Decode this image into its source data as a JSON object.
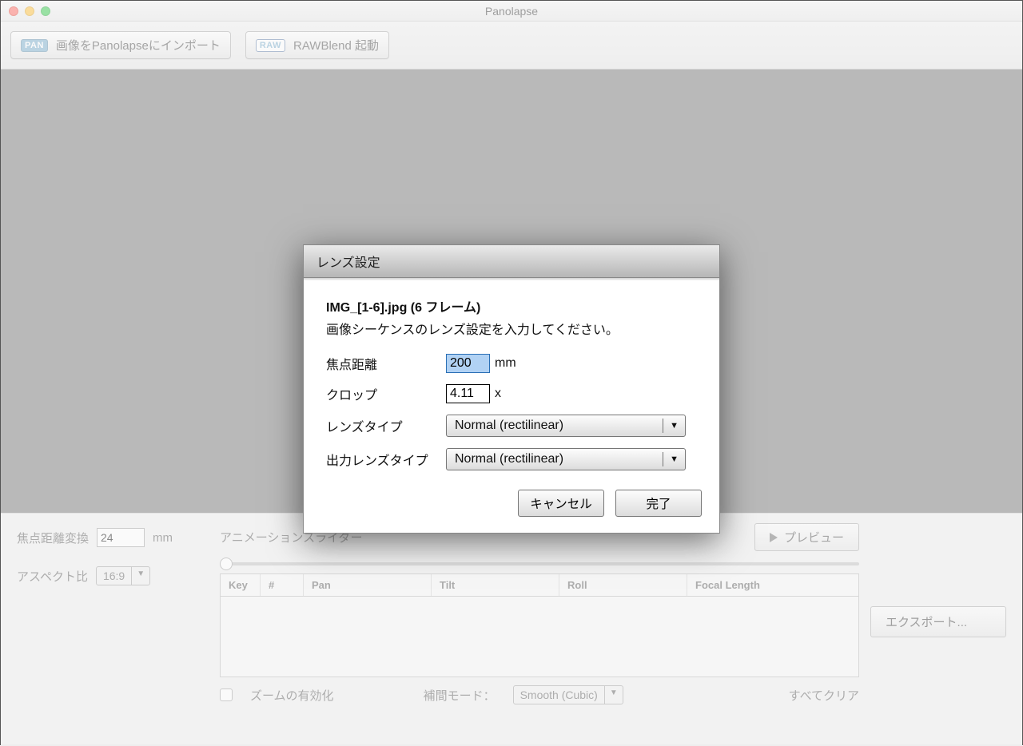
{
  "window": {
    "title": "Panolapse"
  },
  "toolbar": {
    "import_badge": "PAN",
    "import_label": "画像をPanolapseにインポート",
    "raw_badge": "RAW",
    "raw_label": "RAWBlend 起動"
  },
  "left": {
    "focal_conv_label": "焦点距離変換",
    "focal_conv_value": "24",
    "focal_conv_unit": "mm",
    "aspect_label": "アスペクト比",
    "aspect_value": "16:9"
  },
  "right": {
    "anim_label": "アニメーションスライダー",
    "preview": "プレビュー",
    "table": {
      "key": "Key",
      "num": "#",
      "pan": "Pan",
      "tilt": "Tilt",
      "roll": "Roll",
      "foc": "Focal Length"
    },
    "zoom_enable": "ズームの有効化",
    "interp_label": "補間モード：",
    "interp_value": "Smooth (Cubic)",
    "clear_all": "すべてクリア",
    "export": "エクスポート..."
  },
  "modal": {
    "title": "レンズ設定",
    "filename": "IMG_[1-6].jpg (6 フレーム)",
    "instruct": "画像シーケンスのレンズ設定を入力してください。",
    "focal_label": "焦点距離",
    "focal_value": "200",
    "focal_unit": "mm",
    "crop_label": "クロップ",
    "crop_value": "4.11",
    "crop_unit": "x",
    "lens_type_label": "レンズタイプ",
    "lens_type_value": "Normal (rectilinear)",
    "out_lens_label": "出力レンズタイプ",
    "out_lens_value": "Normal (rectilinear)",
    "cancel": "キャンセル",
    "done": "完了"
  }
}
